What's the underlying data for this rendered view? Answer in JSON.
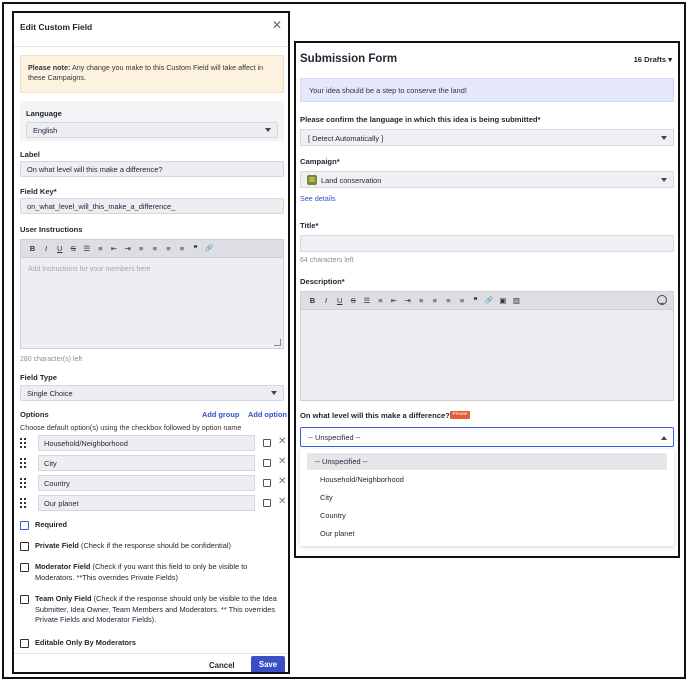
{
  "left_panel": {
    "title": "Edit Custom Field",
    "close_icon": "✕",
    "note": {
      "prefix": "Please note:",
      "text": " Any change you make to this Custom Field will take affect in these Campaigns."
    },
    "language": {
      "label": "Language",
      "value": "English"
    },
    "label_field": {
      "label": "Label",
      "value": "On what level will this make a difference?"
    },
    "field_key": {
      "label": "Field Key*",
      "value": "on_what_level_will_this_make_a_difference_"
    },
    "user_instructions": {
      "label": "User Instructions",
      "placeholder": "Add instructions for your members here",
      "toolbar": [
        "B",
        "I",
        "U",
        "S",
        "☰",
        "≡",
        "⇤",
        "⇥",
        "≡",
        "≡",
        "≡",
        "≡",
        "❞",
        "🔗"
      ],
      "chars_left": "280 character(s) left"
    },
    "field_type": {
      "label": "Field Type",
      "value": "Single Choice"
    },
    "options": {
      "label": "Options",
      "add_group": "Add group",
      "add_option": "Add option",
      "help": "Choose default option(s) using the checkbox followed by option name",
      "items": [
        "Household/Neighborhood",
        "City",
        "Country",
        "Our planet"
      ]
    },
    "checkboxes": {
      "required": {
        "title": "Required",
        "desc": ""
      },
      "private": {
        "title": "Private Field",
        "desc": " (Check if the response should be confidential)"
      },
      "moderator": {
        "title": "Moderator Field",
        "desc": " (Check if you want this field to only be visible to Moderators. **This overrides Private Fields)"
      },
      "team_only": {
        "title": "Team Only Field",
        "desc": " (Check if the response should only be visible to the Idea Submitter, Idea Owner, Team Members and Moderators. ** This overrides Private Fields and Moderator Fields)."
      },
      "editable": {
        "title": "Editable Only By Moderators",
        "desc": ""
      }
    },
    "cancel_label": "Cancel",
    "save_label": "Save"
  },
  "right_panel": {
    "title": "Submission Form",
    "drafts": "16 Drafts ▾",
    "banner": "Your idea should be a step to conserve the land!",
    "language": {
      "label": "Please confirm the language in which this idea is being submitted*",
      "value": "[ Detect Automatically ]"
    },
    "campaign": {
      "label": "Campaign*",
      "value": "Land conservation",
      "details_link": "See details"
    },
    "title_field": {
      "label": "Title*",
      "value": "",
      "chars_left": "64 characters left"
    },
    "description": {
      "label": "Description*",
      "toolbar": [
        "B",
        "I",
        "U",
        "S",
        "☰",
        "≡",
        "⇤",
        "⇥",
        "≡",
        "≡",
        "≡",
        "≡",
        "❞",
        "🔗",
        "▣",
        "▨"
      ]
    },
    "level_question": {
      "label": "On what level will this make a difference?*",
      "badge": "Private",
      "selected": "-- Unspecified --",
      "options": [
        "-- Unspecified --",
        "Household/Neighborhood",
        "City",
        "Country",
        "Our planet"
      ]
    }
  },
  "colors": {
    "accent": "#3b4fc4",
    "note_bg": "#fdf2e2",
    "banner_bg": "#e4e8fa",
    "private_badge": "#e55c3a"
  }
}
